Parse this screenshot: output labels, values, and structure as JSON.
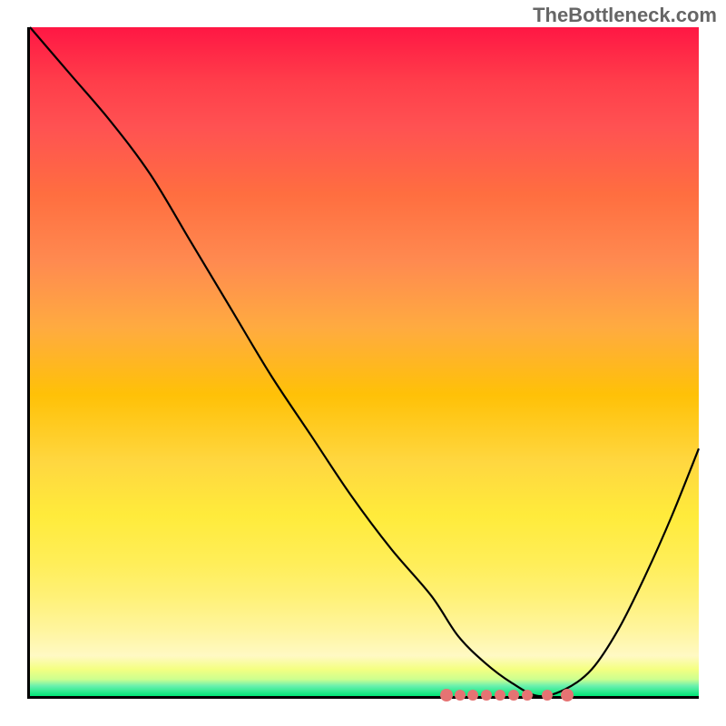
{
  "watermark": "TheBottleneck.com",
  "chart_data": {
    "type": "line",
    "title": "",
    "xlabel": "",
    "ylabel": "",
    "xlim": [
      0,
      100
    ],
    "ylim": [
      0,
      100
    ],
    "grid": false,
    "background_gradient": {
      "orientation": "vertical",
      "stops": [
        {
          "pos": 0.0,
          "color": "#ff1744"
        },
        {
          "pos": 0.25,
          "color": "#ff6e40"
        },
        {
          "pos": 0.55,
          "color": "#ffc107"
        },
        {
          "pos": 0.8,
          "color": "#ffee58"
        },
        {
          "pos": 0.96,
          "color": "#f4ff81"
        },
        {
          "pos": 1.0,
          "color": "#00e676"
        }
      ]
    },
    "series": [
      {
        "name": "bottleneck-curve",
        "x": [
          0,
          6,
          12,
          18,
          24,
          30,
          36,
          42,
          48,
          54,
          60,
          64,
          68,
          72,
          76,
          80,
          84,
          88,
          92,
          96,
          100
        ],
        "y": [
          100,
          93,
          86,
          78,
          68,
          58,
          48,
          39,
          30,
          22,
          15,
          9,
          5,
          2,
          0,
          1,
          4,
          10,
          18,
          27,
          37
        ]
      }
    ],
    "markers": {
      "name": "optimal-range",
      "color": "#e57373",
      "points_x": [
        62,
        64,
        66,
        68,
        70,
        72,
        74,
        77,
        80
      ],
      "y_level": 0.5
    },
    "annotations": []
  }
}
